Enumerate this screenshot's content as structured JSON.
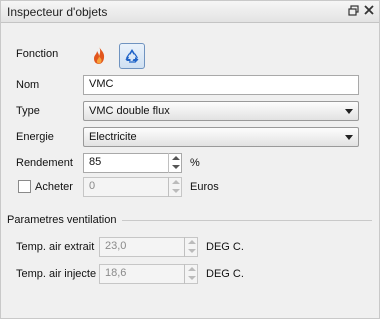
{
  "panel": {
    "title": "Inspecteur d'objets",
    "float_icon": "float-window-icon",
    "close_icon": "close-icon"
  },
  "fonction": {
    "label": "Fonction",
    "icons": [
      "fire-icon",
      "recycle-icon"
    ]
  },
  "nom": {
    "label": "Nom",
    "value": "VMC"
  },
  "type": {
    "label": "Type",
    "value": "VMC double flux"
  },
  "energie": {
    "label": "Energie",
    "value": "Electricite"
  },
  "rendement": {
    "label": "Rendement",
    "value": "85",
    "unit": "%"
  },
  "acheter": {
    "label": "Acheter",
    "checked": false,
    "value": "0",
    "unit": "Euros"
  },
  "parametres": {
    "title": "Parametres ventilation",
    "extrait": {
      "label": "Temp. air extrait",
      "value": "23,0",
      "unit": "DEG C."
    },
    "injecte": {
      "label": "Temp. air injecte",
      "value": "18,6",
      "unit": "DEG C."
    }
  },
  "colors": {
    "recycle": "#1f63c8",
    "flame": "#e2561d"
  }
}
